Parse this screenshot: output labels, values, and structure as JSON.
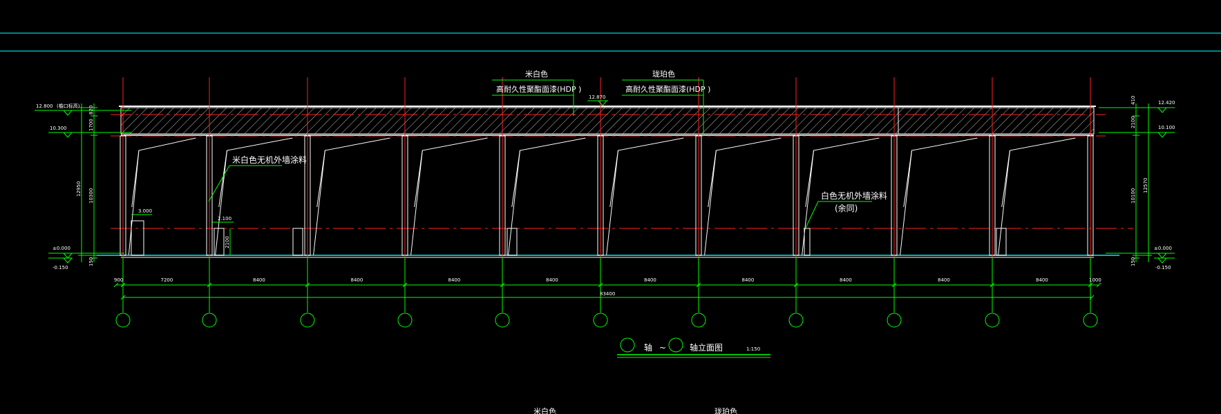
{
  "colors": {
    "background": "#000000",
    "cyan": "#00b4b4",
    "green": "#00ff00",
    "red": "#ff2020",
    "white": "#ffffff"
  },
  "callouts": {
    "top_left_color": "米白色",
    "top_left_material": "高耐久性聚酯面漆(HDP )",
    "top_right_color": "珑珀色",
    "top_right_material": "高耐久性聚酯面漆(HDP )",
    "wall_left": "米白色无机外墙涂料",
    "wall_right_line1": "白色无机外墙涂料",
    "wall_right_line2": "(余同)"
  },
  "levels": {
    "left_top": "12.800",
    "left_top_note": "(檐口标高)",
    "left_beam": "10.300",
    "left_ground": "±0.000",
    "left_bottom": "-0.150",
    "mid_top": "12.870",
    "right_top": "12.420",
    "right_beam": "10.100",
    "right_ground": "±0.000",
    "right_bottom": "-0.150",
    "small_block_a": "3.000",
    "small_block_b": "2.100"
  },
  "vertical_dims": {
    "left": [
      "820",
      "1700",
      "10300",
      "150"
    ],
    "left_total": "12950",
    "right": [
      "410",
      "2100",
      "10100",
      "150"
    ],
    "right_total": "12570",
    "small_block": "2100"
  },
  "bay_dims": [
    "900",
    "7200",
    "8400",
    "8400",
    "8400",
    "8400",
    "8400",
    "8400",
    "8400",
    "8400",
    "8400",
    "1000"
  ],
  "overall_dim": "83400",
  "axis_count": 11,
  "title": {
    "axis_word": "轴",
    "tilde": "~",
    "suffix": "轴立面图",
    "scale": "1:150"
  },
  "bottom_cut": {
    "left": "米白色",
    "right": "珑珀色"
  }
}
